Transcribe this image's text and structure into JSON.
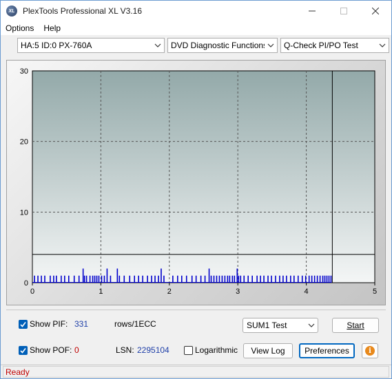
{
  "window": {
    "title": "PlexTools Professional XL V3.16",
    "icon_text": "XL"
  },
  "menu": {
    "items": [
      {
        "label": "Options"
      },
      {
        "label": "Help"
      }
    ]
  },
  "toolbar": {
    "drive_select": "HA:5 ID:0  PX-760A",
    "function_select": "DVD Diagnostic Functions",
    "test_select": "Q-Check PI/PO Test"
  },
  "chart_data": {
    "type": "bar",
    "xlim": [
      0,
      5
    ],
    "ylim": [
      0,
      30
    ],
    "x_ticks": [
      "0",
      "1",
      "2",
      "3",
      "4",
      "5"
    ],
    "y_ticks": [
      "0",
      "10",
      "20",
      "30"
    ],
    "grid": true,
    "threshold_y": 4,
    "end_marker_x": 4.38,
    "series": [
      {
        "color": "#0000cc",
        "x": [
          0.03,
          0.08,
          0.13,
          0.18,
          0.26,
          0.31,
          0.35,
          0.42,
          0.47,
          0.53,
          0.61,
          0.68,
          0.74,
          0.76,
          0.79,
          0.84,
          0.88,
          0.91,
          0.94,
          0.97,
          1.01,
          1.05,
          1.09,
          1.14,
          1.24,
          1.27,
          1.34,
          1.42,
          1.49,
          1.55,
          1.61,
          1.68,
          1.74,
          1.79,
          1.84,
          1.88,
          1.92,
          2.05,
          2.12,
          2.18,
          2.25,
          2.33,
          2.39,
          2.46,
          2.52,
          2.58,
          2.61,
          2.65,
          2.69,
          2.73,
          2.77,
          2.81,
          2.85,
          2.88,
          2.92,
          2.95,
          2.99,
          3.01,
          3.04,
          3.09,
          3.15,
          3.21,
          3.28,
          3.33,
          3.38,
          3.44,
          3.49,
          3.55,
          3.61,
          3.66,
          3.71,
          3.77,
          3.82,
          3.88,
          3.94,
          3.99,
          4.04,
          4.08,
          4.12,
          4.16,
          4.2,
          4.24,
          4.27,
          4.3,
          4.33,
          4.36
        ],
        "values": [
          1,
          1,
          1,
          1,
          1,
          1,
          1,
          1,
          1,
          1,
          1,
          1,
          2,
          1,
          1,
          1,
          1,
          1,
          1,
          1,
          1,
          1,
          2,
          1,
          2,
          1,
          1,
          1,
          1,
          1,
          1,
          1,
          1,
          1,
          1,
          2,
          1,
          1,
          1,
          1,
          1,
          1,
          1,
          1,
          1,
          2,
          1,
          1,
          1,
          1,
          1,
          1,
          1,
          1,
          1,
          1,
          2,
          1,
          1,
          1,
          1,
          1,
          1,
          1,
          1,
          1,
          1,
          1,
          1,
          1,
          1,
          1,
          1,
          1,
          1,
          1,
          1,
          1,
          1,
          1,
          1,
          1,
          1,
          1,
          1,
          1
        ]
      }
    ]
  },
  "controls": {
    "show_pif_label": "Show PIF:",
    "pif_value": "331",
    "pif_unit": "rows/1ECC",
    "show_pof_label": "Show POF:",
    "pof_value": "0",
    "lsn_label": "LSN:",
    "lsn_value": "2295104",
    "logarithmic_label": "Logarithmic",
    "sum_select": "SUM1 Test",
    "start_label": "Start",
    "view_log_label": "View Log",
    "preferences_label": "Preferences",
    "show_pif_checked": true,
    "show_pof_checked": true,
    "logarithmic_checked": false
  },
  "status": {
    "text": "Ready"
  },
  "colors": {
    "accent": "#005fb8",
    "status_text": "#c00000",
    "bar": "#0000cc"
  }
}
